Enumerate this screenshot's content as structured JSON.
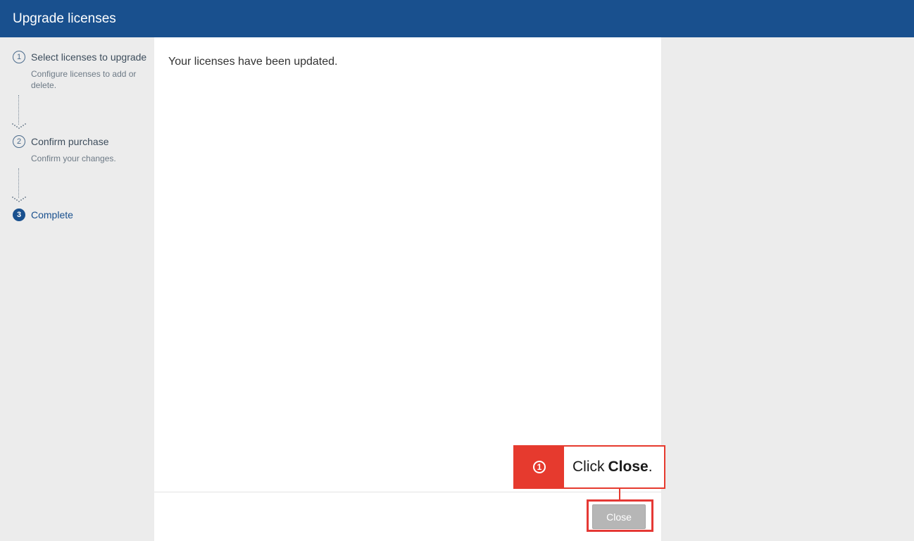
{
  "header": {
    "title": "Upgrade licenses"
  },
  "steps": [
    {
      "number": "1",
      "title": "Select licenses to upgrade",
      "desc": "Configure licenses to add or delete.",
      "active": false
    },
    {
      "number": "2",
      "title": "Confirm purchase",
      "desc": "Confirm your changes.",
      "active": false
    },
    {
      "number": "3",
      "title": "Complete",
      "desc": "",
      "active": true
    }
  ],
  "main": {
    "message": "Your licenses have been updated.",
    "close_label": "Close"
  },
  "callout": {
    "number": "1",
    "text_prefix": "Click ",
    "text_bold": "Close",
    "text_suffix": "."
  }
}
